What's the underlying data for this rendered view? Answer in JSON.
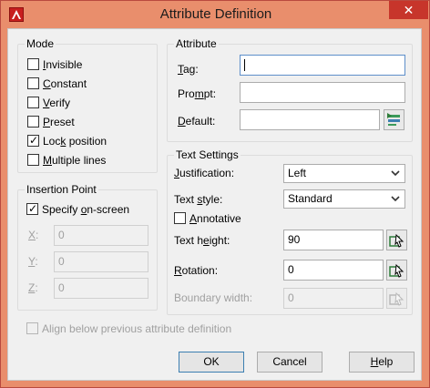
{
  "window": {
    "title": "Attribute Definition",
    "close_glyph": "✕"
  },
  "mode": {
    "title": "Mode",
    "items": [
      {
        "pre": "",
        "key": "I",
        "post": "nvisible",
        "checked": false
      },
      {
        "pre": "",
        "key": "C",
        "post": "onstant",
        "checked": false
      },
      {
        "pre": "",
        "key": "V",
        "post": "erify",
        "checked": false
      },
      {
        "pre": "",
        "key": "P",
        "post": "reset",
        "checked": false
      },
      {
        "pre": "Loc",
        "key": "k",
        "post": " position",
        "checked": true
      },
      {
        "pre": "",
        "key": "M",
        "post": "ultiple lines",
        "checked": false
      }
    ]
  },
  "insertion": {
    "title": "Insertion Point",
    "specify": {
      "pre": "Specify ",
      "key": "o",
      "post": "n-screen",
      "checked": true
    },
    "x": {
      "key": "X",
      "post": ":",
      "value": "0"
    },
    "y": {
      "key": "Y",
      "post": ":",
      "value": "0"
    },
    "z": {
      "key": "Z",
      "post": ":",
      "value": "0"
    }
  },
  "attribute": {
    "title": "Attribute",
    "tag": {
      "key": "T",
      "post": "ag:",
      "value": ""
    },
    "prompt": {
      "pre": "Pro",
      "key": "m",
      "post": "pt:",
      "value": ""
    },
    "default": {
      "pre": "",
      "key": "D",
      "post": "efault:",
      "value": ""
    }
  },
  "text_settings": {
    "title": "Text Settings",
    "justification": {
      "pre": "",
      "key": "J",
      "post": "ustification:",
      "value": "Left"
    },
    "text_style": {
      "pre": "Text ",
      "key": "s",
      "post": "tyle:",
      "value": "Standard"
    },
    "annotative": {
      "pre": "",
      "key": "A",
      "post": "nnotative",
      "checked": false
    },
    "text_height": {
      "pre": "Text h",
      "key": "e",
      "post": "ight:",
      "value": "90"
    },
    "rotation": {
      "pre": "",
      "key": "R",
      "post": "otation:",
      "value": "0"
    },
    "boundary_width": {
      "label": "Boundary width:",
      "value": "0"
    }
  },
  "align_below": {
    "label": "Align below previous attribute definition",
    "checked": false
  },
  "buttons": {
    "ok": "OK",
    "cancel": "Cancel",
    "help_key": "H",
    "help_post": "elp"
  }
}
